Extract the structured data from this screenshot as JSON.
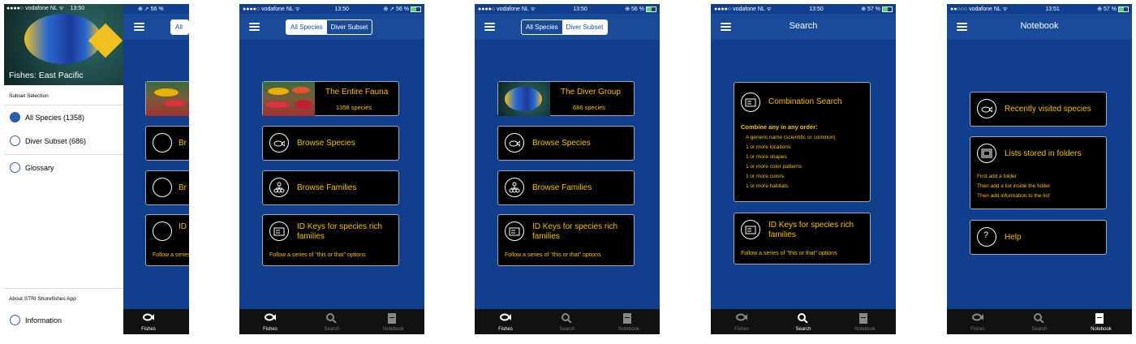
{
  "status": {
    "carrier": "vodafone NL",
    "screens": [
      {
        "time": "13:50",
        "battery": "56 %",
        "level": 0.56
      },
      {
        "time": "13:50",
        "battery": "56 %",
        "level": 0.56
      },
      {
        "time": "13:50",
        "battery": "56 %",
        "level": 0.56
      },
      {
        "time": "13:50",
        "battery": "57 %",
        "level": 0.57
      },
      {
        "time": "13:51",
        "battery": "57 %",
        "level": 0.57
      }
    ]
  },
  "drawer": {
    "title": "Fishes: East Pacific",
    "subset_heading": "Subset Selection",
    "items": [
      "All Species (1358)",
      "Diver Subset (686)",
      "Glossary"
    ],
    "about_heading": "About STRI Shorefishes App",
    "info": "Information"
  },
  "segment": {
    "all": "All Species",
    "diver": "Diver Subset",
    "partial": "All S"
  },
  "fauna": {
    "title": "The Entire Fauna",
    "count": "1358 species"
  },
  "diver": {
    "title": "The Diver Group",
    "count": "686 species"
  },
  "browse_species": "Browse Species",
  "browse_species_partial": "Br",
  "browse_families": "Browse Families",
  "browse_families_partial": "Br",
  "idkeys": {
    "title1": "ID Keys for species rich",
    "title2": "families",
    "partial1": "ID",
    "sub": "Follow a series of \"this or that\" options"
  },
  "search": {
    "title": "Search",
    "combo_title": "Combination Search",
    "combo_heading": "Combine any in any order:",
    "combo_items": [
      "A generic name (scientific or common)",
      "1 or more locations",
      "1 or more shapes",
      "1 or more color patterns",
      "1 or more colors",
      "1 or more habitats"
    ]
  },
  "notebook": {
    "title": "Notebook",
    "recent": "Recently visited species",
    "lists": "Lists stored in folders",
    "lists_sub": [
      "First add a folder",
      "Then add a list inside the folder",
      "Then add information to the list"
    ],
    "help": "Help"
  },
  "tabs": {
    "fishes": "Fishes",
    "search": "Search",
    "notebook": "Notebook"
  },
  "colors": {
    "navy": "#113f8e",
    "accent": "#f5c000"
  }
}
